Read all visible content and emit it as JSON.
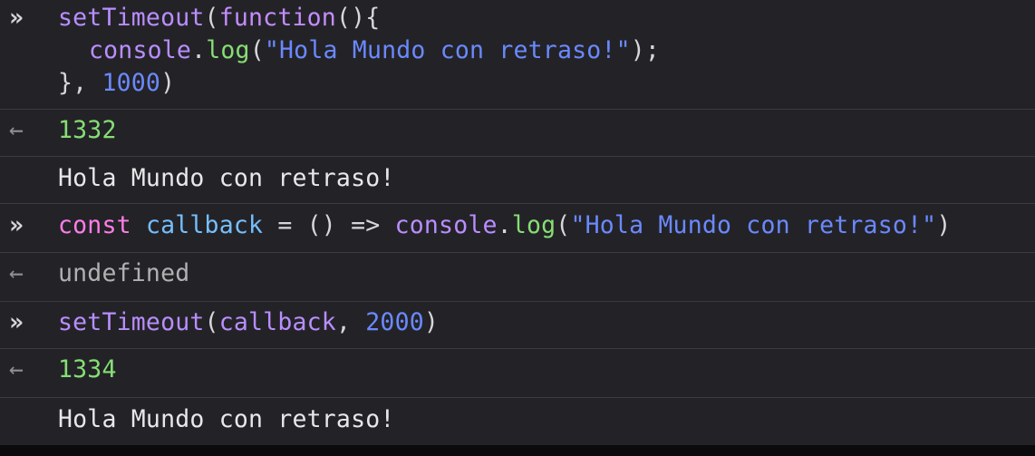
{
  "entries": [
    {
      "type": "input",
      "lines": [
        [
          "setTimeout",
          "(",
          "function",
          "(){"
        ],
        [
          "console",
          ".",
          "log",
          "(",
          "\"Hola Mundo con retraso!\"",
          ");"
        ],
        [
          "}, ",
          "1000",
          ")"
        ]
      ]
    },
    {
      "type": "result",
      "value": "1332"
    },
    {
      "type": "log",
      "value": "Hola Mundo con retraso!"
    },
    {
      "type": "input",
      "lines": [
        [
          "const",
          " ",
          "callback",
          " = () => ",
          "console",
          ".",
          "log",
          "(",
          "\"Hola Mundo con retraso!\"",
          ")"
        ]
      ]
    },
    {
      "type": "result",
      "value": "undefined"
    },
    {
      "type": "input",
      "lines": [
        [
          "setTimeout",
          "(",
          "callback",
          ", ",
          "2000",
          ")"
        ]
      ]
    },
    {
      "type": "result",
      "value": "1334"
    },
    {
      "type": "log",
      "value": "Hola Mundo con retraso!"
    }
  ],
  "icons": {
    "prompt": "»",
    "result_arrow": "←"
  },
  "colors": {
    "background": "#232327",
    "result_number": "#86de74",
    "keyword_function": "#c58cff",
    "keyword_const": "#ff7de9",
    "identifier": "#75bfff",
    "string": "#6b89ff"
  }
}
